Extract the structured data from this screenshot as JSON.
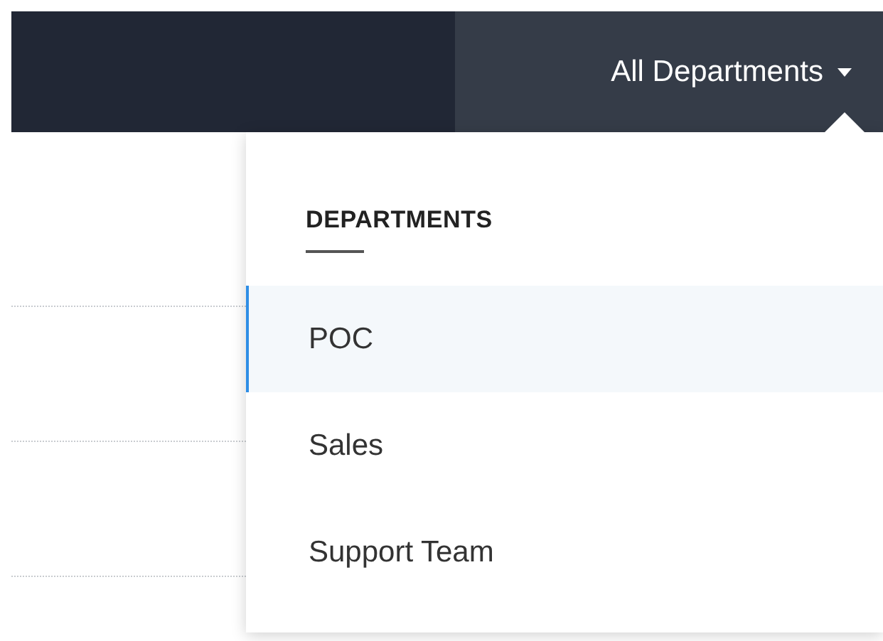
{
  "header": {
    "department_selector": {
      "label": "All Departments",
      "expanded": true
    }
  },
  "dropdown": {
    "heading": "DEPARTMENTS",
    "items": [
      {
        "label": "POC",
        "selected": true
      },
      {
        "label": "Sales",
        "selected": false
      },
      {
        "label": "Support Team",
        "selected": false
      }
    ]
  }
}
